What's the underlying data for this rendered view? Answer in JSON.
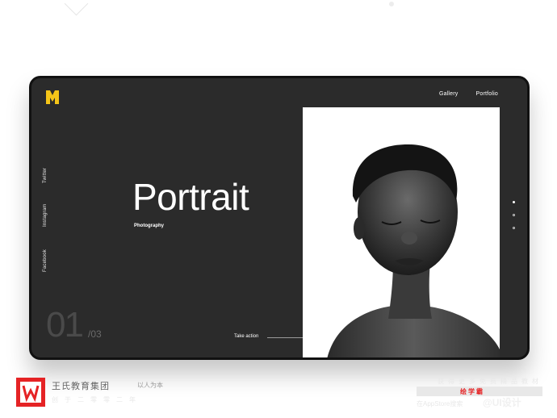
{
  "nav": {
    "items": [
      "Gallery",
      "Portfolio"
    ]
  },
  "social": [
    "Twitter",
    "Instagram",
    "Facebook"
  ],
  "hero": {
    "title": "Portrait",
    "subtitle": "Photography",
    "cta": "Take action"
  },
  "pager": {
    "current": "01",
    "total": "/03",
    "dots_count": 3,
    "active_index": 0
  },
  "colors": {
    "panel": "#2b2b2b",
    "accent_yellow": "#f5c518",
    "brand_red": "#e52325"
  },
  "icons": {
    "logo": "m-logo-icon",
    "brand": "w-brand-icon"
  },
  "footer": {
    "brand_name": "王氏教育集团",
    "brand_slogan": "以人为本",
    "brand_sub": "创于二零零二年",
    "promo_line": "获得更多免费精品教材",
    "promo_red": "绘学霸",
    "promo_bottom": "在AppStore搜索",
    "watermark": "@UI设计"
  }
}
